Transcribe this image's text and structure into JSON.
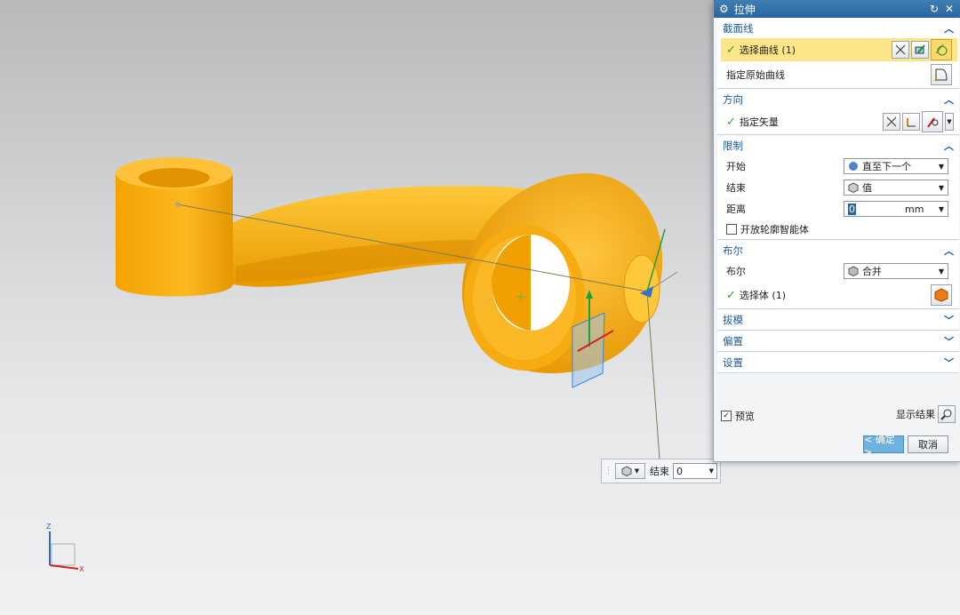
{
  "dialog": {
    "title": "拉伸",
    "colors": {
      "title_bar": "#2f6ea8",
      "section_header": "#1e5a96",
      "highlight": "#fde58a"
    },
    "sections": {
      "section_curve": {
        "header": "截面线",
        "select_curve": "选择曲线 (1)",
        "specify_original": "指定原始曲线"
      },
      "direction": {
        "header": "方向",
        "specify_vector": "指定矢量"
      },
      "limits": {
        "header": "限制",
        "start_label": "开始",
        "start_value": "直至下一个",
        "end_label": "结束",
        "end_value": "值",
        "distance_label": "距离",
        "distance_value": "0",
        "distance_unit": "mm",
        "open_profile": "开放轮廓智能体"
      },
      "boolean": {
        "header": "布尔",
        "boolean_label": "布尔",
        "boolean_value": "合并",
        "select_body": "选择体 (1)"
      },
      "draft": {
        "header": "拔模"
      },
      "offset": {
        "header": "偏置"
      },
      "settings": {
        "header": "设置"
      }
    },
    "preview_label": "预览",
    "show_result_label": "显示结果",
    "ok_label": "< 确定 >",
    "cancel_label": "取消"
  },
  "dynamic_input": {
    "label": "结束",
    "value": "0"
  },
  "axes": {
    "z": "Z",
    "x": "X"
  },
  "model": {
    "part_color": "#f5a800"
  }
}
